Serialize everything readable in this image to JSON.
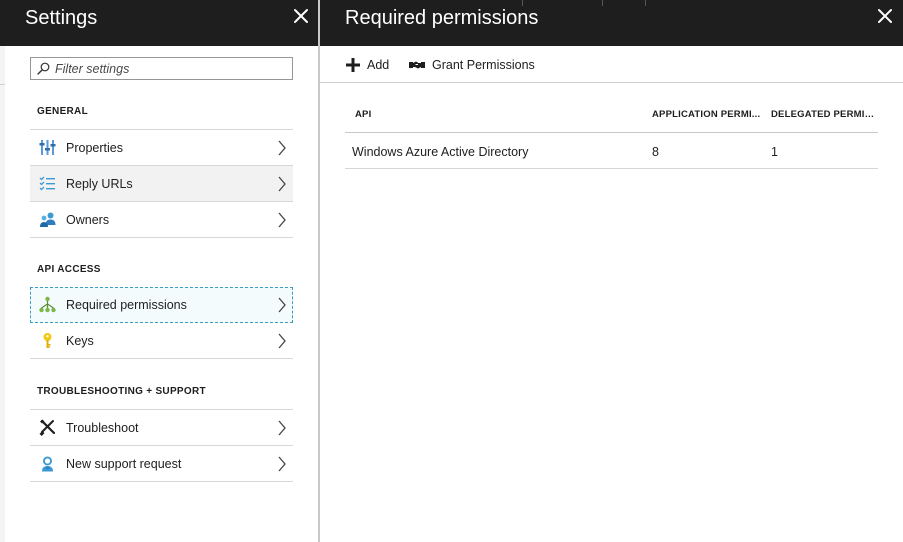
{
  "settings_blade": {
    "title": "Settings",
    "filter": {
      "placeholder": "Filter settings",
      "value": ""
    },
    "sections": [
      {
        "title": "GENERAL",
        "items": [
          {
            "label": "Properties",
            "icon": "properties-icon"
          },
          {
            "label": "Reply URLs",
            "icon": "reply-urls-icon"
          },
          {
            "label": "Owners",
            "icon": "owners-icon"
          }
        ]
      },
      {
        "title": "API ACCESS",
        "items": [
          {
            "label": "Required permissions",
            "icon": "required-permissions-icon"
          },
          {
            "label": "Keys",
            "icon": "key-icon"
          }
        ]
      },
      {
        "title": "TROUBLESHOOTING + SUPPORT",
        "items": [
          {
            "label": "Troubleshoot",
            "icon": "troubleshoot-icon"
          },
          {
            "label": "New support request",
            "icon": "support-request-icon"
          }
        ]
      }
    ],
    "selected_item": "Required permissions",
    "hovered_item": "Reply URLs"
  },
  "permissions_blade": {
    "title": "Required permissions",
    "commands": [
      {
        "label": "Add",
        "icon": "plus-icon"
      },
      {
        "label": "Grant Permissions",
        "icon": "grant-permissions-icon"
      }
    ],
    "table": {
      "columns": [
        "API",
        "APPLICATION PERMI...",
        "DELEGATED PERMIS..."
      ],
      "rows": [
        {
          "api": "Windows Azure Active Directory",
          "application_permissions": "8",
          "delegated_permissions": "1"
        }
      ]
    }
  },
  "colors": {
    "header_bg": "#1e1e1e",
    "selection_border": "#3aa0c2",
    "selection_bg": "#f3fbfd",
    "hover_bg": "#f2f2f2",
    "icon_blue": "#3c9ad3",
    "icon_green": "#7ab648",
    "icon_yellow": "#f2c811"
  }
}
